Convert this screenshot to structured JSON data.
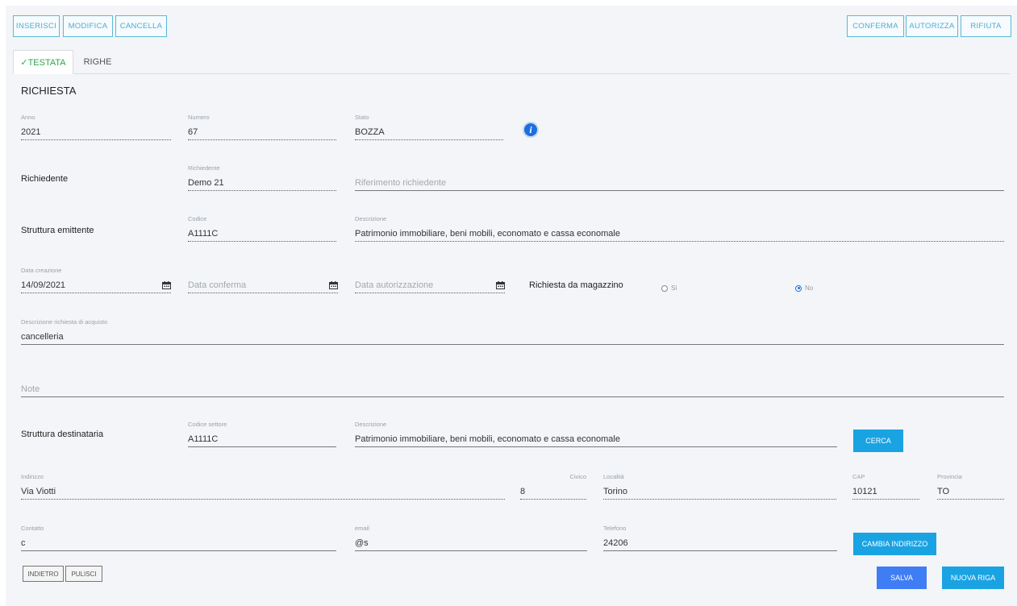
{
  "toolbar": {
    "left": [
      "INSERISCI",
      "MODIFICA",
      "CANCELLA"
    ],
    "right": [
      "CONFERMA",
      "AUTORIZZA",
      "RIFIUTA"
    ]
  },
  "tabs": {
    "active": "✓TESTATA",
    "other": "RIGHE"
  },
  "section_title": "RICHIESTA",
  "row1": {
    "anno": {
      "label": "Anno",
      "value": "2021"
    },
    "numero": {
      "label": "Numero",
      "value": "67"
    },
    "stato": {
      "label": "Stato",
      "value": "BOZZA"
    },
    "info_icon": "i"
  },
  "richiedente": {
    "row_label": "Richiedente",
    "label": "Richiedente",
    "value": "Demo 21",
    "riferimento_placeholder": "Riferimento richiedente"
  },
  "struttura_emittente": {
    "row_label": "Struttura emittente",
    "codice_label": "Codice",
    "codice": "A1111C",
    "descrizione_label": "Descrizione",
    "descrizione": "Patrimonio immobiliare, beni mobili, economato e cassa economale"
  },
  "date": {
    "creazione_label": "Data creazione",
    "creazione": "14/09/2021",
    "conferma_placeholder": "Data conferma",
    "autorizzazione_placeholder": "Data autorizzazione"
  },
  "magazzino": {
    "label": "Richiesta da magazzino",
    "si": "Sì",
    "no": "No",
    "selected": "No"
  },
  "descrizione_acquisto": {
    "label": "Descrizione richiesta di acquisto",
    "value": "cancelleria"
  },
  "note_placeholder": "Note",
  "struttura_destinataria": {
    "row_label": "Struttura destinataria",
    "codice_label": "Codice settore",
    "codice": "A1111C",
    "descrizione_label": "Descrizione",
    "descrizione": "Patrimonio immobiliare, beni mobili, economato e cassa economale",
    "cerca": "CERCA"
  },
  "indirizzo": {
    "indirizzo_label": "Indirizzo",
    "indirizzo": "Via Viotti",
    "civico_label": "Civico",
    "civico": "8",
    "localita_label": "Località",
    "localita": "Torino",
    "cap_label": "CAP",
    "cap": "10121",
    "provincia_label": "Provincia",
    "provincia": "TO"
  },
  "contatti": {
    "contatto_label": "Contatto",
    "contatto": "c",
    "email_label": "email",
    "email": "@s",
    "telefono_label": "Telefono",
    "telefono": "24206",
    "cambia": "CAMBIA INDIRIZZO"
  },
  "footer": {
    "indietro": "INDIETRO",
    "pulisci": "PULISCI",
    "salva": "SALVA",
    "nuova_riga": "NUOVA RIGA"
  },
  "colors": {
    "accent": "#1aa3e3",
    "save": "#3f7df5",
    "tab_active": "#2aa84a",
    "outline": "#5bb8d8"
  }
}
